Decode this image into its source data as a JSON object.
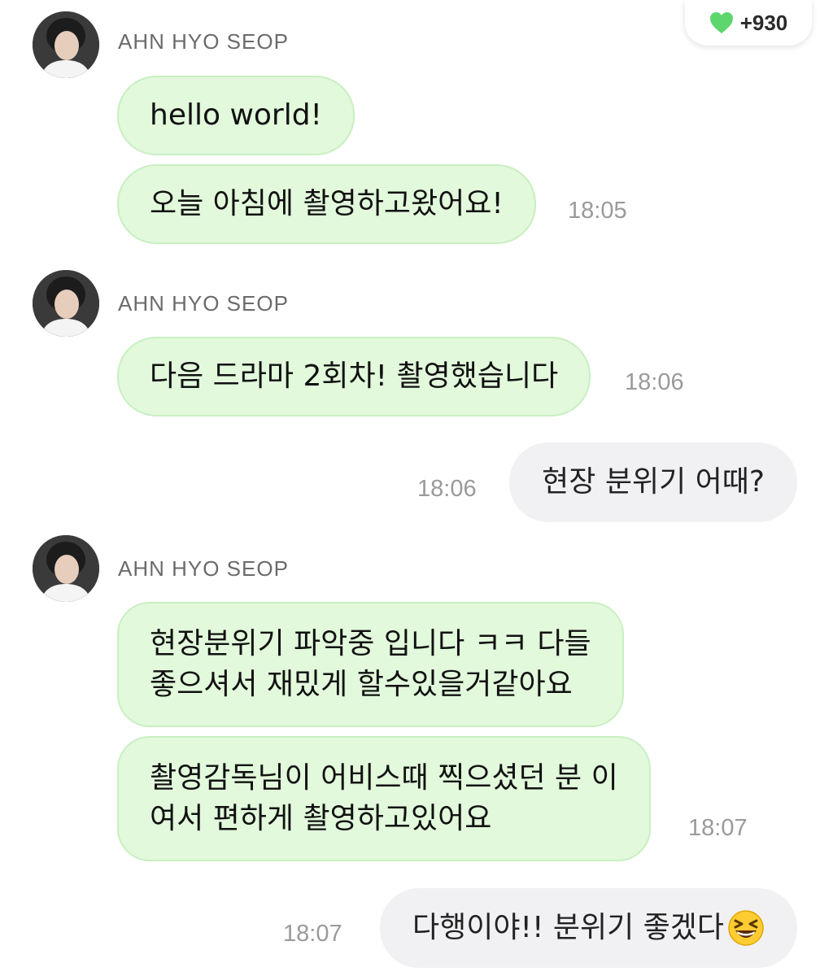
{
  "likes": {
    "count": "+930",
    "icon": "heart-icon",
    "icon_color": "#5ed66e"
  },
  "colors": {
    "incoming_bubble": "#e2f9dc",
    "outgoing_bubble": "#f1f1f4"
  },
  "messages": [
    {
      "sender": "AHN HYO SEOP",
      "bubbles": [
        "hello world!",
        "오늘 아침에 촬영하고왔어요!"
      ],
      "time": "18:05"
    },
    {
      "sender": "AHN HYO SEOP",
      "bubbles": [
        "다음 드라마 2회차! 촬영했습니다"
      ],
      "time": "18:06"
    },
    {
      "outgoing": true,
      "text": "현장 분위기 어때?",
      "time": "18:06"
    },
    {
      "sender": "AHN HYO SEOP",
      "bubbles": [
        [
          "현장분위기 파악중 입니다 ㅋㅋ 다들",
          "좋으셔서 재밌게 할수있을거같아요"
        ],
        [
          "촬영감독님이 어비스때 찍으셨던 분 이",
          "여서 편하게 촬영하고있어요"
        ]
      ],
      "time": "18:07"
    },
    {
      "outgoing": true,
      "text": "다행이야!! 분위기 좋겠다",
      "emoji": "grinning-squinting-face-emoji",
      "time": "18:07"
    }
  ]
}
